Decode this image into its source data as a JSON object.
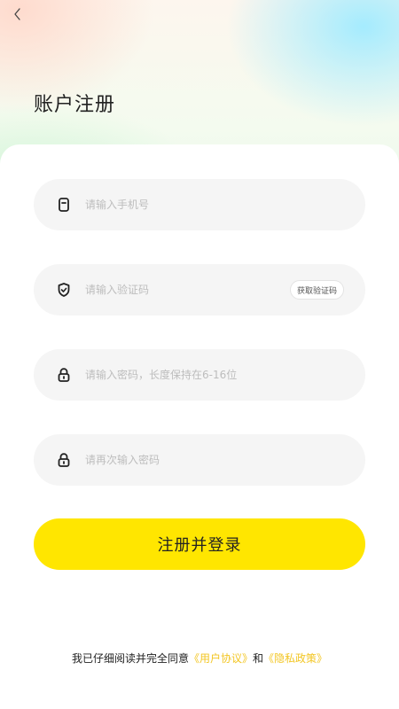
{
  "header": {
    "back_icon": "chevron-left-icon",
    "title": "账户注册"
  },
  "form": {
    "phone": {
      "icon": "phone-icon",
      "placeholder": "请输入手机号",
      "value": ""
    },
    "code": {
      "icon": "shield-check-icon",
      "placeholder": "请输入验证码",
      "value": "",
      "get_code_label": "获取验证码"
    },
    "password": {
      "icon": "lock-icon",
      "placeholder": "请输入密码，长度保持在6-16位",
      "value": ""
    },
    "confirm_password": {
      "icon": "lock-icon",
      "placeholder": "请再次输入密码",
      "value": ""
    }
  },
  "submit": {
    "label": "注册并登录"
  },
  "agreement": {
    "prefix": "我已仔细阅读并完全同意",
    "user_agreement": "《用户协议》",
    "joiner": "和",
    "privacy_policy": "《隐私政策》"
  },
  "colors": {
    "accent": "#ffe600",
    "link": "#f3c623",
    "field_bg": "#f5f5f5",
    "placeholder": "#bdbdbd"
  }
}
